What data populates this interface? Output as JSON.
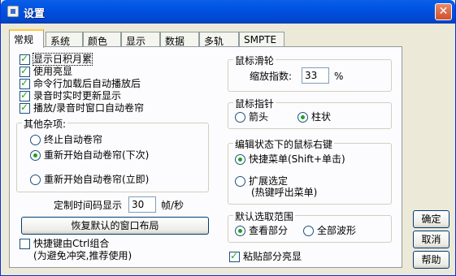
{
  "window": {
    "title": "设置"
  },
  "tabs": [
    "常规",
    "系统",
    "颜色",
    "显示",
    "数据",
    "多轨",
    "SMPTE"
  ],
  "general": {
    "checkboxes": [
      {
        "label": "显示日积月累",
        "checked": true
      },
      {
        "label": "使用亮显",
        "checked": true
      },
      {
        "label": "命令行加载后自动播放后",
        "checked": true
      },
      {
        "label": "录音时实时更新显示",
        "checked": true
      },
      {
        "label": "播放/录音时窗口自动卷帘",
        "checked": true
      }
    ],
    "misc": {
      "title": "其他杂项:",
      "options": [
        "终止自动卷帘",
        "重新开始自动卷帘(下次)",
        "重新开始自动卷帘(立即)"
      ],
      "selected": 1
    },
    "timecode_label": "定制时间码显示",
    "timecode_value": "30",
    "timecode_unit": "帧/秒",
    "restore_button": "恢复默认的窗口布局",
    "ctrl_shortcut": {
      "label": "快捷键由Ctrl组合",
      "sublabel": "(为避免冲突,推荐使用)",
      "checked": false
    }
  },
  "wheel": {
    "title": "鼠标滑轮",
    "zoom_label": "缩放指数:",
    "zoom_value": "33",
    "zoom_unit": "%"
  },
  "pointer": {
    "title": "鼠标指针",
    "options": [
      "箭头",
      "柱状"
    ],
    "selected": 1
  },
  "rightclick": {
    "title": "编辑状态下的鼠标右键",
    "options": [
      "快捷菜单(Shift+单击)",
      "扩展选定"
    ],
    "option2_sub": "(热键呼出菜单)",
    "selected": 0
  },
  "selection": {
    "title": "默认选取范围",
    "options": [
      "查看部分",
      "全部波形"
    ],
    "selected": 0
  },
  "paste": {
    "label": "粘贴部分亮显",
    "checked": true
  },
  "buttons": {
    "ok": "确定",
    "cancel": "取消",
    "help": "帮助"
  }
}
